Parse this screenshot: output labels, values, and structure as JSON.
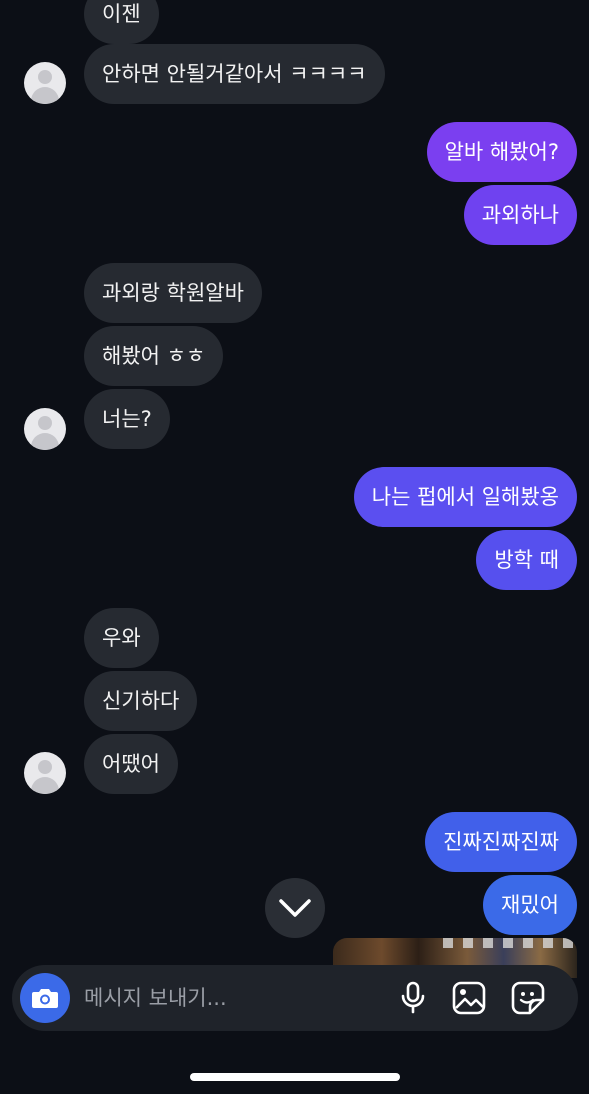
{
  "messages": {
    "m0": "이젠",
    "m1": "안하면 안될거같아서 ㅋㅋㅋㅋ",
    "m2": "알바 해봤어?",
    "m3": "과외하나",
    "m4": "과외랑 학원알바",
    "m5": "해봤어 ㅎㅎ",
    "m6": "너는?",
    "m7": "나는 펍에서 일해봤옹",
    "m8": "방학 때",
    "m9": "우와",
    "m10": "신기하다",
    "m11": "어땠어",
    "m12": "진짜진짜진짜",
    "m13": "재밌어"
  },
  "composer": {
    "placeholder": "메시지 보내기..."
  },
  "icons": {
    "avatar": "default-avatar-icon",
    "scroll": "chevron-down-icon",
    "camera": "camera-icon",
    "mic": "microphone-icon",
    "gallery": "image-icon",
    "sticker": "sticker-icon"
  },
  "colors": {
    "background": "#0c0f16",
    "incoming_bubble": "#262a31",
    "outgoing_top": "#7b3ff0",
    "outgoing_mid": "#5b4ff0",
    "outgoing_bottom": "#3b6ae8",
    "camera_button": "#3b6ae8"
  }
}
